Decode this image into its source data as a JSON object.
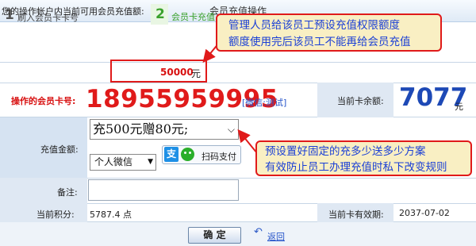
{
  "window": {
    "title": "会员充值操作"
  },
  "steps": [
    {
      "number": "1",
      "label": "刷入会员卡卡号"
    },
    {
      "number": "2",
      "label": "会员卡充值"
    }
  ],
  "quota": {
    "label": "您的操作帐户内当前可用会员充值额:",
    "value": "50000",
    "unit": "元"
  },
  "card": {
    "label": "操作的会员卡号:",
    "number": "18955959995",
    "note": "[微信:测试]"
  },
  "balance": {
    "label": "当前卡余额:",
    "value": "7077",
    "unit": "元"
  },
  "amount": {
    "label": "充值金额:",
    "plan_selected": "充500元赠80元;",
    "payment_selected": "个人微信",
    "scan_label": "扫码支付",
    "alipay_glyph": "支"
  },
  "remark": {
    "label": "备注:",
    "value": ""
  },
  "points": {
    "label": "当前积分:",
    "value": "5787.4 点"
  },
  "expiry": {
    "label": "当前卡有效期:",
    "value": "2037-07-02"
  },
  "footer": {
    "confirm_label": "确 定",
    "back_label": "返回"
  },
  "annotations": {
    "quota_note": [
      "管理人员给该员工预设充值权限额度",
      "额度使用完后该员工不能再给会员充值"
    ],
    "plan_note": [
      "预设置好固定的充多少送多少方案",
      "有效防止员工办理充值时私下改变规则"
    ]
  },
  "colors": {
    "accent_red": "#e01a1a",
    "balance_blue": "#1d49b6",
    "callout_bg": "#f9efc3",
    "callout_text": "#1a3fd6"
  }
}
